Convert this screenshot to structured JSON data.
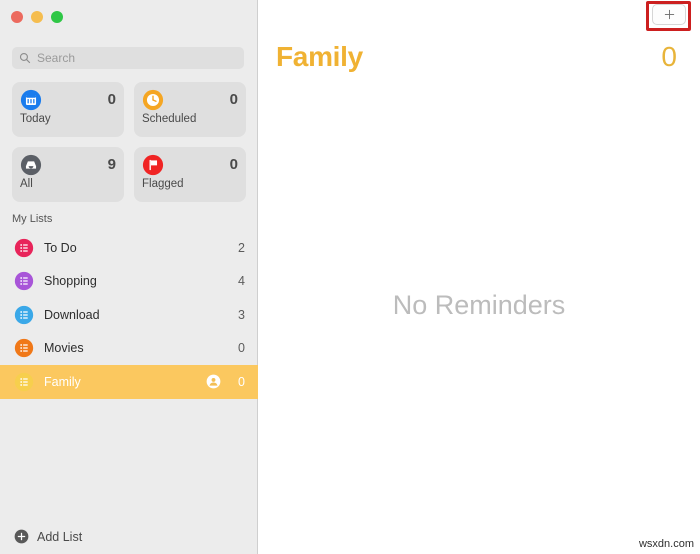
{
  "window": {
    "traffic_lights": [
      {
        "name": "close",
        "color": "#ec6a5e"
      },
      {
        "name": "minimize",
        "color": "#f5bd4f"
      },
      {
        "name": "maximize",
        "color": "#2fc746"
      }
    ]
  },
  "sidebar": {
    "search": {
      "value": "",
      "placeholder": "Search",
      "icon": "search-icon"
    },
    "smart_cards": [
      {
        "label": "Today",
        "count": "0",
        "icon": "calendar-icon",
        "icon_color": "#1a7ced"
      },
      {
        "label": "Scheduled",
        "count": "0",
        "icon": "clock-icon",
        "icon_color": "#f5a623"
      },
      {
        "label": "All",
        "count": "9",
        "icon": "inbox-icon",
        "icon_color": "#5b5f66"
      },
      {
        "label": "Flagged",
        "count": "0",
        "icon": "flag-icon",
        "icon_color": "#f02424"
      }
    ],
    "section_title": "My Lists",
    "lists": [
      {
        "label": "To Do",
        "count": "2",
        "icon": "list-icon",
        "icon_color": "#e8245a",
        "selected": false,
        "shared": false
      },
      {
        "label": "Shopping",
        "count": "4",
        "icon": "list-icon",
        "icon_color": "#a855d8",
        "selected": false,
        "shared": false
      },
      {
        "label": "Download",
        "count": "3",
        "icon": "list-icon",
        "icon_color": "#3aa8e8",
        "selected": false,
        "shared": false
      },
      {
        "label": "Movies",
        "count": "0",
        "icon": "list-icon",
        "icon_color": "#f07818",
        "selected": false,
        "shared": false
      },
      {
        "label": "Family",
        "count": "0",
        "icon": "list-icon",
        "icon_color": "#f7cf4d",
        "selected": true,
        "shared": true
      }
    ],
    "add_list": {
      "label": "Add List",
      "icon": "plus-circle-icon"
    }
  },
  "main": {
    "add_button": {
      "label": "+",
      "icon": "plus-icon"
    },
    "title": "Family",
    "count": "0",
    "empty_state": "No Reminders",
    "accent_color": "#f0b233"
  },
  "watermark": "wsxdn.com"
}
